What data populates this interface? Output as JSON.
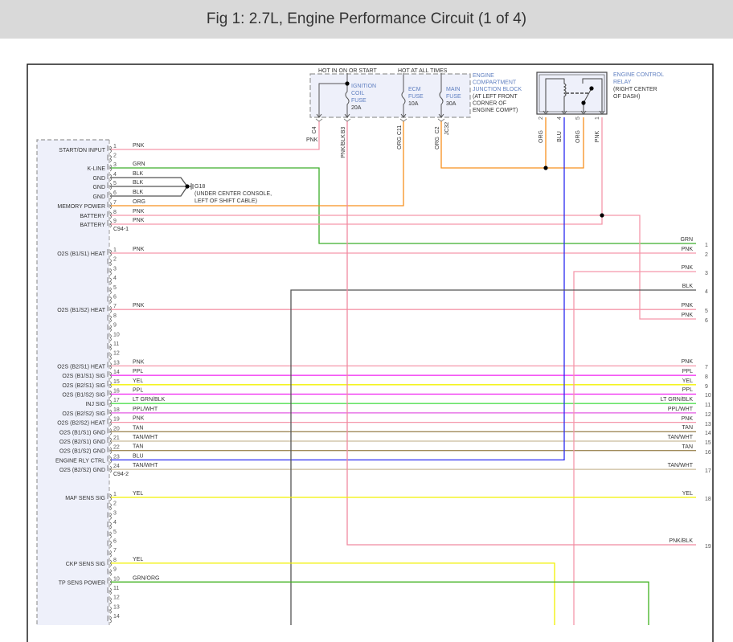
{
  "header": {
    "title": "Fig 1: 2.7L, Engine Performance Circuit (1 of 4)"
  },
  "wire_colors": {
    "PNK": "#f597aa",
    "GRN": "#3cae2a",
    "BLK": "#555555",
    "ORG": "#f7901e",
    "PPL": "#f021f0",
    "YEL": "#f2f200",
    "LT GRN/BLK": "#52df52",
    "PPL/WHT": "#e45ce4",
    "TAN": "#a08a5a",
    "TAN/WHT": "#cbbc9c",
    "BLU": "#2b2bf2",
    "PNK/BLK": "#f08aa0",
    "GRN/ORG": "#3fb21f"
  },
  "module": {
    "connectors": [
      {
        "id": "C94-1",
        "pins": [
          {
            "num": "1",
            "name": "START/ON INPUT",
            "wire": "PNK"
          },
          {
            "num": "2",
            "name": "",
            "wire": ""
          },
          {
            "num": "3",
            "name": "K-LINE",
            "wire": "GRN"
          },
          {
            "num": "4",
            "name": "GND",
            "wire": "BLK"
          },
          {
            "num": "5",
            "name": "GND",
            "wire": "BLK"
          },
          {
            "num": "6",
            "name": "GND",
            "wire": "BLK"
          },
          {
            "num": "7",
            "name": "MEMORY POWER",
            "wire": "ORG"
          },
          {
            "num": "8",
            "name": "BATTERY",
            "wire": "PNK"
          },
          {
            "num": "9",
            "name": "BATTERY",
            "wire": "PNK"
          }
        ]
      },
      {
        "id": "C94-2",
        "pins": [
          {
            "num": "1",
            "name": "O2S (B1/S1) HEAT",
            "wire": "PNK"
          },
          {
            "num": "2",
            "name": "",
            "wire": ""
          },
          {
            "num": "3",
            "name": "",
            "wire": ""
          },
          {
            "num": "4",
            "name": "",
            "wire": ""
          },
          {
            "num": "5",
            "name": "",
            "wire": ""
          },
          {
            "num": "6",
            "name": "",
            "wire": ""
          },
          {
            "num": "7",
            "name": "O2S (B1/S2) HEAT",
            "wire": "PNK"
          },
          {
            "num": "8",
            "name": "",
            "wire": ""
          },
          {
            "num": "9",
            "name": "",
            "wire": ""
          },
          {
            "num": "10",
            "name": "",
            "wire": ""
          },
          {
            "num": "11",
            "name": "",
            "wire": ""
          },
          {
            "num": "12",
            "name": "",
            "wire": ""
          },
          {
            "num": "13",
            "name": "O2S (B2/S1) HEAT",
            "wire": "PNK"
          },
          {
            "num": "14",
            "name": "O2S (B1/S1) SIG",
            "wire": "PPL"
          },
          {
            "num": "15",
            "name": "O2S (B2/S1) SIG",
            "wire": "YEL"
          },
          {
            "num": "16",
            "name": "O2S (B1/S2) SIG",
            "wire": "PPL"
          },
          {
            "num": "17",
            "name": "INJ SIG",
            "wire": "LT GRN/BLK"
          },
          {
            "num": "18",
            "name": "O2S (B2/S2) SIG",
            "wire": "PPL/WHT"
          },
          {
            "num": "19",
            "name": "O2S (B2/S2) HEAT",
            "wire": "PNK"
          },
          {
            "num": "20",
            "name": "O2S (B1/S1) GND",
            "wire": "TAN"
          },
          {
            "num": "21",
            "name": "O2S (B2/S1) GND",
            "wire": "TAN/WHT"
          },
          {
            "num": "22",
            "name": "O2S (B1/S2) GND",
            "wire": "TAN"
          },
          {
            "num": "23",
            "name": "ENGINE RLY CTRL",
            "wire": "BLU"
          },
          {
            "num": "24",
            "name": "O2S (B2/S2) GND",
            "wire": "TAN/WHT"
          }
        ]
      },
      {
        "id": "",
        "pins": [
          {
            "num": "1",
            "name": "MAF SENS SIG",
            "wire": "YEL"
          },
          {
            "num": "2",
            "name": "",
            "wire": ""
          },
          {
            "num": "3",
            "name": "",
            "wire": ""
          },
          {
            "num": "4",
            "name": "",
            "wire": ""
          },
          {
            "num": "5",
            "name": "",
            "wire": ""
          },
          {
            "num": "6",
            "name": "",
            "wire": ""
          },
          {
            "num": "7",
            "name": "",
            "wire": ""
          },
          {
            "num": "8",
            "name": "CKP SENS SIG",
            "wire": "YEL"
          },
          {
            "num": "9",
            "name": "",
            "wire": ""
          },
          {
            "num": "10",
            "name": "TP SENS POWER",
            "wire": "GRN/ORG"
          },
          {
            "num": "11",
            "name": "",
            "wire": ""
          },
          {
            "num": "12",
            "name": "",
            "wire": ""
          },
          {
            "num": "13",
            "name": "",
            "wire": ""
          },
          {
            "num": "14",
            "name": "",
            "wire": ""
          },
          {
            "num": "15",
            "name": "",
            "wire": ""
          }
        ]
      }
    ]
  },
  "right_ends": [
    {
      "num": "1",
      "wire": "GRN"
    },
    {
      "num": "2",
      "wire": "PNK"
    },
    {
      "num": "3",
      "wire": "PNK"
    },
    {
      "num": "4",
      "wire": "BLK"
    },
    {
      "num": "5",
      "wire": "PNK"
    },
    {
      "num": "6",
      "wire": "PNK"
    },
    {
      "num": "7",
      "wire": "PNK"
    },
    {
      "num": "8",
      "wire": "PPL"
    },
    {
      "num": "9",
      "wire": "YEL"
    },
    {
      "num": "10",
      "wire": "PPL"
    },
    {
      "num": "11",
      "wire": "LT GRN/BLK"
    },
    {
      "num": "12",
      "wire": "PPL/WHT"
    },
    {
      "num": "13",
      "wire": "PNK"
    },
    {
      "num": "14",
      "wire": "TAN"
    },
    {
      "num": "15",
      "wire": "TAN/WHT"
    },
    {
      "num": "16",
      "wire": "TAN"
    },
    {
      "num": "17",
      "wire": "TAN/WHT"
    },
    {
      "num": "18",
      "wire": "YEL"
    },
    {
      "num": "19",
      "wire": "PNK/BLK"
    }
  ],
  "junction_block": {
    "hot_on_start": "HOT IN ON OR START",
    "hot_all_times": "HOT AT ALL TIMES",
    "name_lines": [
      "ENGINE",
      "COMPARTMENT",
      "JUNCTION BLOCK"
    ],
    "location_lines": [
      "(AT LEFT FRONT",
      "CORNER OF",
      "ENGINE COMPT)"
    ],
    "fuses": [
      {
        "name_lines": [
          "IGNITION",
          "COIL",
          "FUSE"
        ],
        "rating": "20A"
      },
      {
        "name_lines": [
          "ECM",
          "FUSE"
        ],
        "rating": "10A"
      },
      {
        "name_lines": [
          "MAIN",
          "FUSE"
        ],
        "rating": "30A"
      }
    ],
    "terminals": [
      {
        "id": "C4",
        "wire": "PNK"
      },
      {
        "id": "B3",
        "wire": "PNK/BLK"
      },
      {
        "id": "C11",
        "wire": "ORG"
      },
      {
        "id": "C2",
        "wire": "ORG"
      }
    ],
    "connector": "JC32"
  },
  "relay": {
    "name_lines": [
      "ENGINE CONTROL",
      "RELAY"
    ],
    "location_lines": [
      "(RIGHT CENTER",
      "OF DASH)"
    ],
    "pins": [
      {
        "num": "2",
        "wire": "ORG"
      },
      {
        "num": "4",
        "wire": "BLU"
      },
      {
        "num": "5",
        "wire": "ORG"
      },
      {
        "num": "1",
        "wire": "PNK"
      }
    ]
  },
  "ground": {
    "id": "G18",
    "location_lines": [
      "(UNDER CENTER CONSOLE,",
      "LEFT OF SHIFT CABLE)"
    ]
  }
}
